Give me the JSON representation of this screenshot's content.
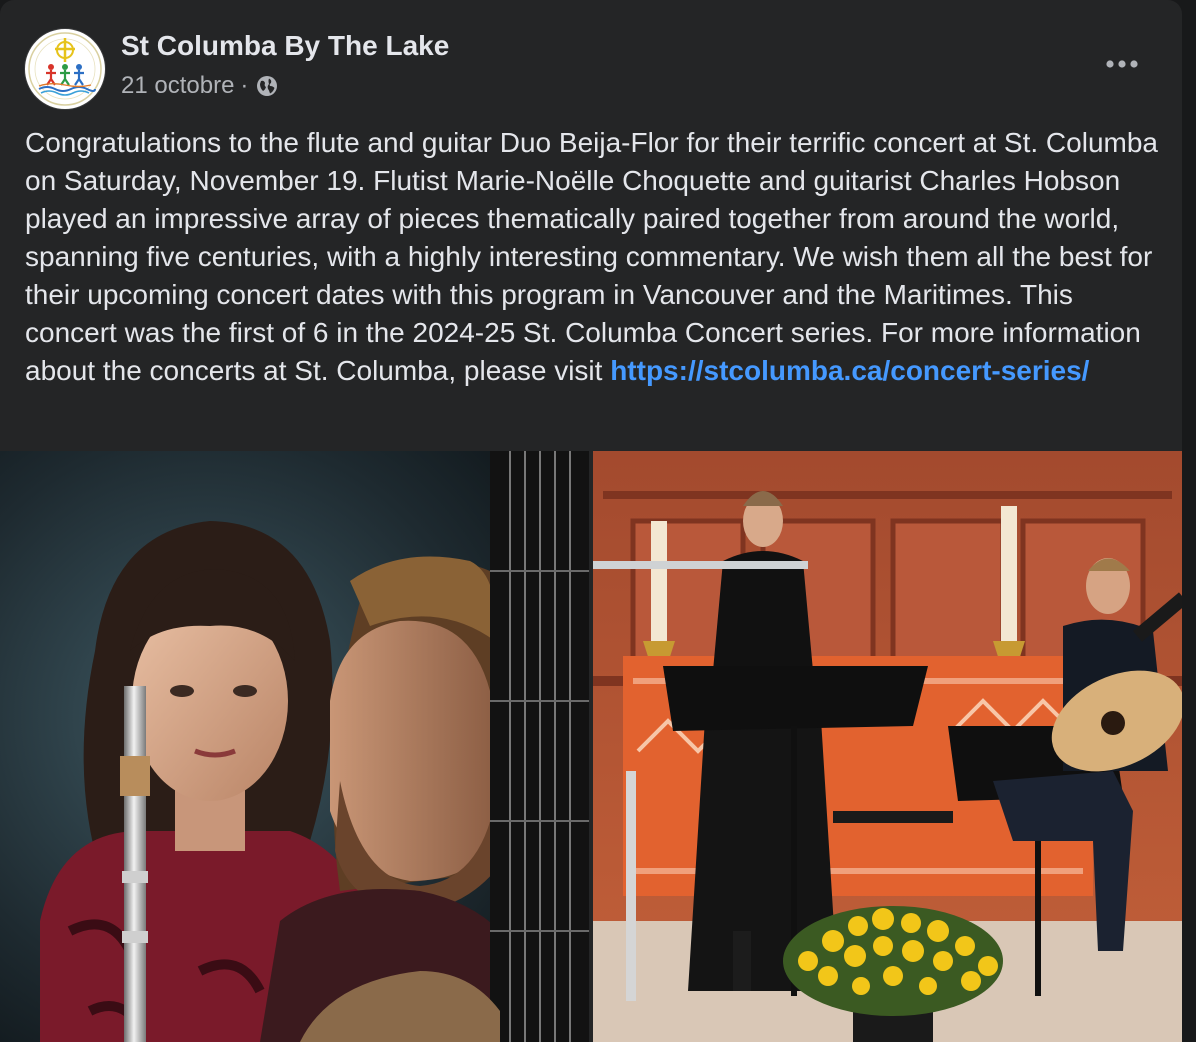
{
  "post": {
    "page_name": "St Columba By The Lake",
    "date": "21 octobre",
    "separator": "·",
    "privacy_icon": "globe-icon",
    "more_icon": "more-options-icon",
    "avatar_icon": "church-logo-icon",
    "body_text": "Congratulations to the flute and guitar Duo Beija-Flor for their terrific concert at St. Columba on Saturday, November 19. Flutist Marie-Noëlle Choquette and guitarist Charles Hobson played an impressive array of pieces thematically paired together from around the world, spanning five centuries, with a highly interesting commentary. We wish them all the best for their upcoming concert dates with this program in Vancouver and the Maritimes. This concert was the first of 6 in the 2024-25 St. Columba Concert series. For more information about the concerts at St. Columba, please visit ",
    "link_text": "https://stcolumba.ca/concert-series/"
  },
  "colors": {
    "card_bg": "#242526",
    "page_bg": "#18191a",
    "text_primary": "#e4e6eb",
    "text_secondary": "#b0b3b8",
    "link": "#4599ff"
  }
}
